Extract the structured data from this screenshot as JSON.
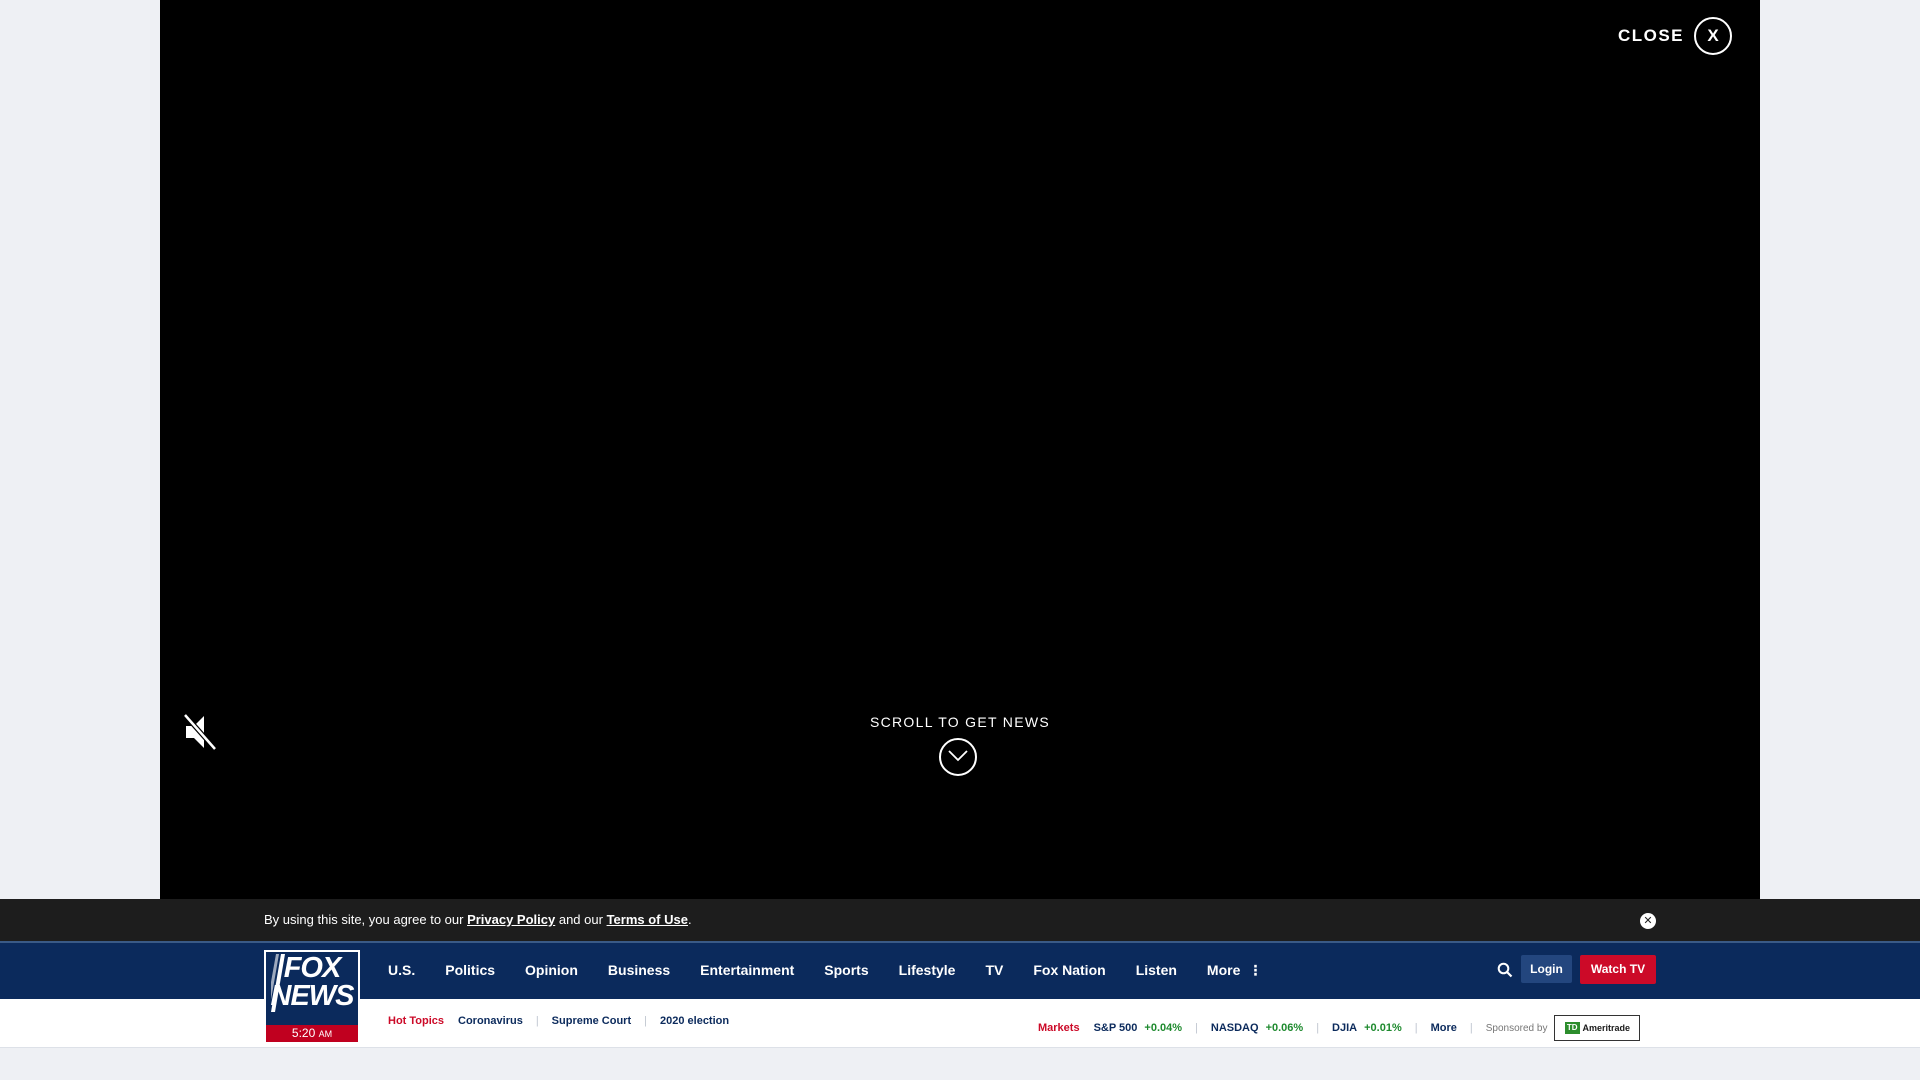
{
  "video": {
    "close_label": "CLOSE",
    "close_symbol": "X",
    "scroll_cta": "SCROLL TO GET NEWS"
  },
  "privacy": {
    "text_before": "By using this site, you agree to our ",
    "privacy_link": "Privacy Policy",
    "text_middle": " and our ",
    "terms_link": "Terms of Use",
    "text_after": ".",
    "close_symbol": "✕"
  },
  "logo": {
    "line1": "FOX",
    "line2": "NEWS",
    "time": "5:20",
    "ampm": "AM"
  },
  "nav": {
    "items": [
      "U.S.",
      "Politics",
      "Opinion",
      "Business",
      "Entertainment",
      "Sports",
      "Lifestyle",
      "TV",
      "Fox Nation",
      "Listen",
      "More"
    ],
    "login_label": "Login",
    "watch_label": "Watch TV"
  },
  "hot_topics": {
    "label": "Hot Topics",
    "items": [
      "Coronavirus",
      "Supreme Court",
      "2020 election"
    ]
  },
  "markets": {
    "label": "Markets",
    "tickers": [
      {
        "name": "S&P 500",
        "change": "+0.04%"
      },
      {
        "name": "NASDAQ",
        "change": "+0.06%"
      },
      {
        "name": "DJIA",
        "change": "+0.01%"
      }
    ],
    "more_label": "More",
    "sponsored_label": "Sponsored by",
    "sponsor_mark": "TD",
    "sponsor_name": "Ameritrade"
  },
  "colors": {
    "nav_bg": "#0b2a5c",
    "accent_red": "#cc0a28",
    "positive": "#1e8a2e"
  }
}
